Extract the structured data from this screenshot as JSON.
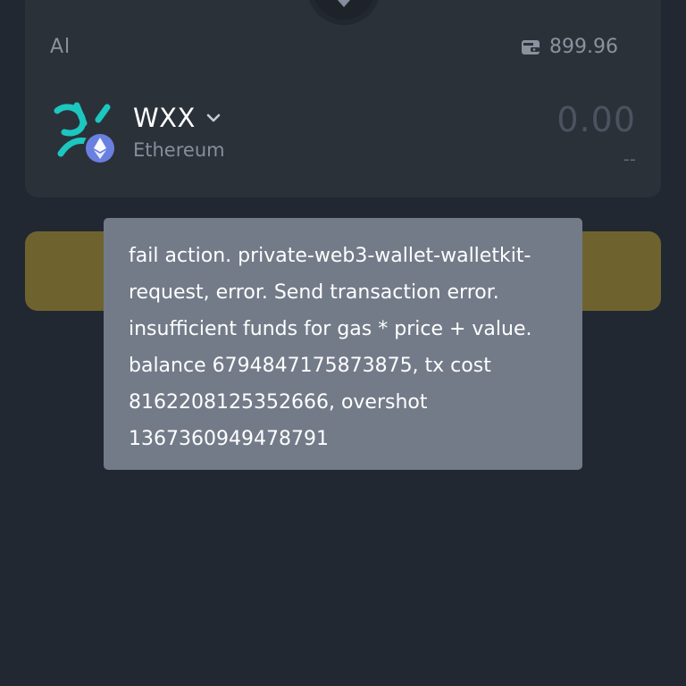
{
  "from_section": {
    "label": "Al",
    "balance": "899.96",
    "balance_icon": "wallet-icon"
  },
  "token": {
    "symbol": "WXX",
    "network": "Ethereum",
    "amount": "0.00",
    "fiat_value": "--",
    "icon": "token-logo-icon",
    "network_badge_icon": "ethereum-icon"
  },
  "swap": {
    "icon": "arrow-down-icon"
  },
  "colors": {
    "background": "#212832",
    "card": "#2b3139",
    "action_button": "#6e632f",
    "toast": "#737b89",
    "token_logo": "#1cc7c0",
    "eth_badge": "#6a80e0"
  },
  "toast": {
    "message": "fail action. private-web3-wallet-walletkit-request, error. Send transaction error. insufficient funds for gas * price + value. balance 6794847175873875, tx cost 8162208125352666, overshot 1367360949478791"
  }
}
